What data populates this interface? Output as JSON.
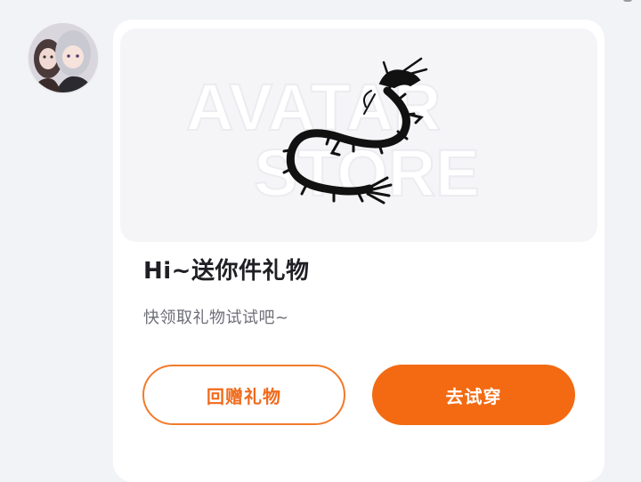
{
  "avatar": {
    "icon": "user-avatar-anime-portrait"
  },
  "gift_card": {
    "banner": {
      "watermark_line1": "AVATAR",
      "watermark_line2": "STORE",
      "image_icon": "black-dragon-illustration"
    },
    "title": "Hi~送你件礼物",
    "subtitle": "快领取礼物试试吧~",
    "buttons": {
      "return_gift_label": "回赠礼物",
      "try_on_label": "去试穿"
    }
  },
  "colors": {
    "accent": "#f36a12",
    "background": "#f2f3f7",
    "card": "#ffffff"
  }
}
